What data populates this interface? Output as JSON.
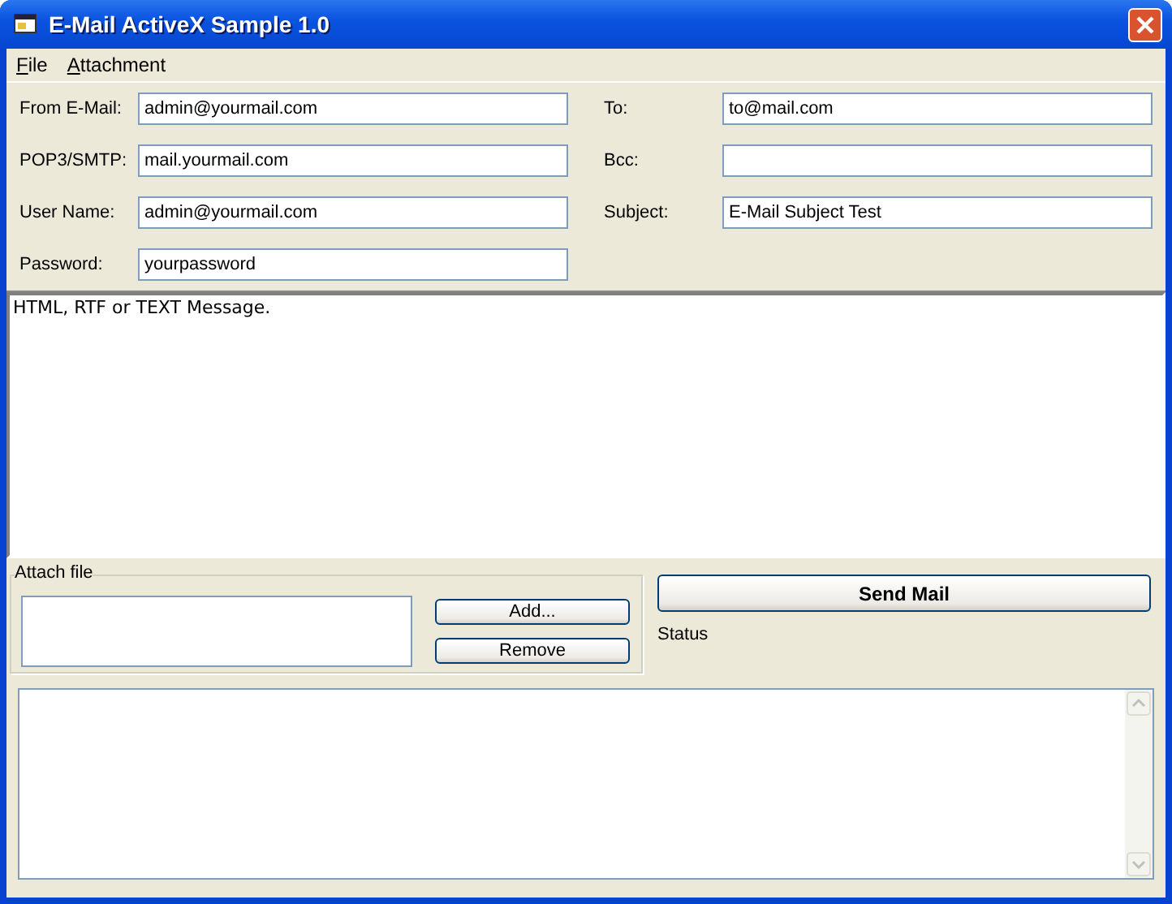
{
  "window": {
    "title": "E-Mail ActiveX Sample 1.0"
  },
  "menu": [
    {
      "label": "File"
    },
    {
      "label": "Attachment"
    }
  ],
  "left_fields": [
    {
      "label": "From E-Mail:",
      "value": "admin@yourmail.com"
    },
    {
      "label": "POP3/SMTP:",
      "value": "mail.yourmail.com"
    },
    {
      "label": "User Name:",
      "value": "admin@yourmail.com"
    },
    {
      "label": "Password:",
      "value": "yourpassword"
    }
  ],
  "right_fields": [
    {
      "label": "To:",
      "value": "to@mail.com"
    },
    {
      "label": "Bcc:"
    },
    {
      "label": "Subject:",
      "value": "E-Mail Subject Test"
    }
  ],
  "message": "HTML, RTF or TEXT Message.",
  "attach": {
    "title": "Attach file",
    "buttons": [
      "Add...",
      "Remove"
    ]
  },
  "send_button": "Send Mail",
  "status_label": "Status"
}
